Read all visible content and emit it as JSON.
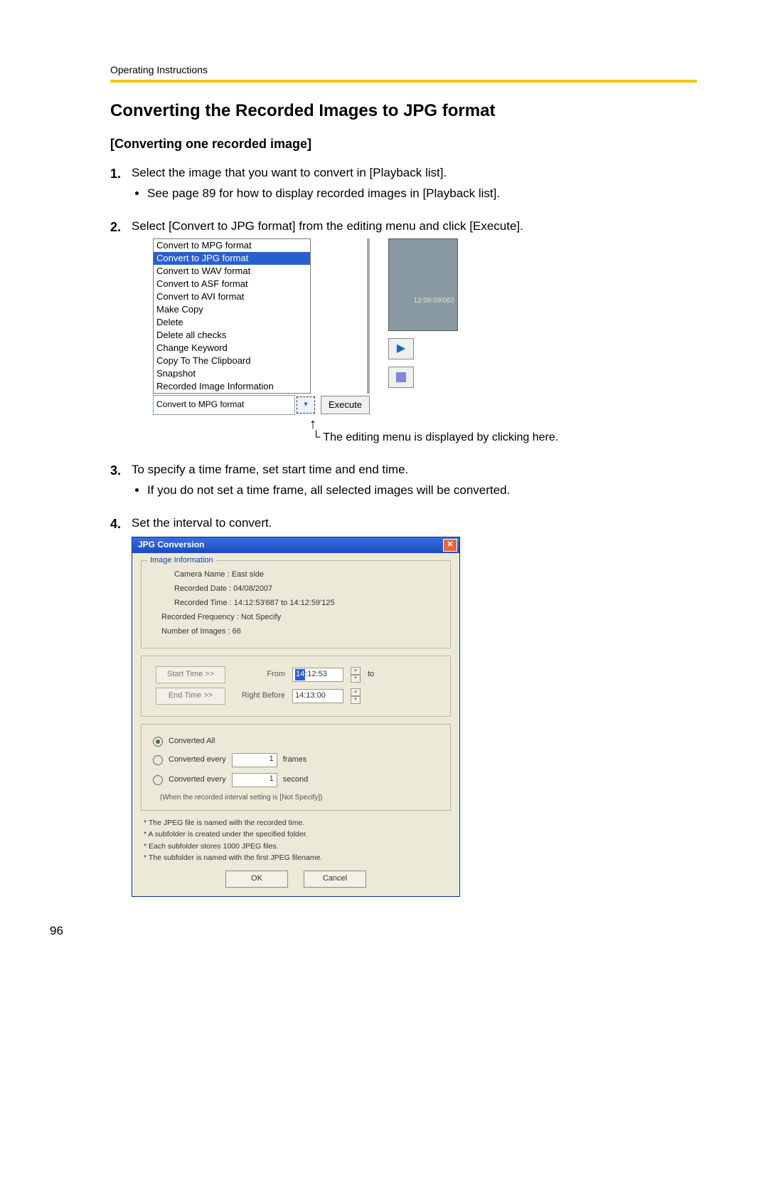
{
  "header": {
    "small": "Operating Instructions"
  },
  "title": "Converting the Recorded Images to JPG format",
  "subtitle": "[Converting one recorded image]",
  "steps": {
    "s1": {
      "num": "1.",
      "text": "Select the image that you want to convert in [Playback list].",
      "sub1": "See page 89 for how to display recorded images in [Playback list]."
    },
    "s2": {
      "num": "2.",
      "text": "Select [Convert to JPG format] from the editing menu and click [Execute]."
    },
    "s3": {
      "num": "3.",
      "text": "To specify a time frame, set start time and end time.",
      "sub1": "If you do not set a time frame, all selected images will be converted."
    },
    "s4": {
      "num": "4.",
      "text": "Set the interval to convert."
    }
  },
  "menu": {
    "items": {
      "i0": "Convert to MPG format",
      "i1": "Convert to JPG format",
      "i2": "Convert to WAV format",
      "i3": "Convert to ASF format",
      "i4": "Convert to AVI format",
      "i5": "Make Copy",
      "i6": "Delete",
      "i7": "Delete all checks",
      "i8": "Change Keyword",
      "i9": "Copy To The Clipboard",
      "i10": "Snapshot",
      "i11": "Recorded Image Information"
    },
    "combo_value": "Convert to MPG format",
    "execute": "Execute",
    "timestamp": "12:08:09'062"
  },
  "callout": {
    "text": "The editing menu is displayed by clicking here."
  },
  "dialog": {
    "title": "JPG Conversion",
    "group_info": "Image Information",
    "camera": "Camera Name : East side",
    "recdate": "Recorded Date : 04/08/2007",
    "rectime": "Recorded Time : 14:12:53'687   to   14:12:59'125",
    "freq": "Recorded Frequency : Not Specify",
    "numimg": "Number of Images : 66",
    "start_btn": "Start Time >>",
    "end_btn": "End Time >>",
    "from_lbl": "From",
    "right_before_lbl": "Right Before",
    "start_val_hl": "14",
    "start_val_rest": ":12:53",
    "end_val": "14:13:00",
    "to_lbl": "to",
    "r_all": "Converted All",
    "r_frames": "Converted every",
    "frames_val": "1",
    "frames_unit": "frames",
    "r_second": "Converted every",
    "second_val": "1",
    "second_unit": "second",
    "note_under": "(When the recorded interval setting is [Not Specify])",
    "n1": "* The JPEG file is named with the recorded time.",
    "n2": "* A subfolder is created under the specified folder.",
    "n3": "* Each subfolder stores 1000 JPEG files.",
    "n4": "* The subfolder is named with the first JPEG filename.",
    "ok": "OK",
    "cancel": "Cancel"
  },
  "page_number": "96"
}
